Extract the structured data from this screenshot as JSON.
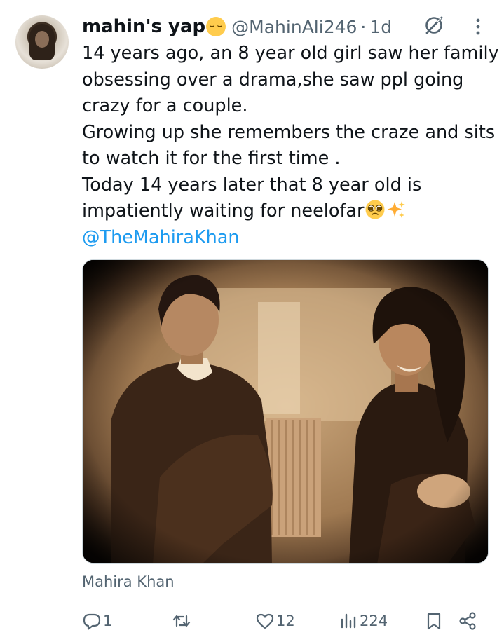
{
  "tweet": {
    "display_name": "mahin's yap",
    "name_emoji": "relieved-face-emoji",
    "handle": "@MahinAli246",
    "separator": "·",
    "time": "1d",
    "text_lines": [
      "14 years ago, an 8 year old girl saw her family",
      "obsessing over a drama,she saw ppl going",
      "crazy for a couple.",
      "Growing up she remembers the craze and sits",
      "to watch it for the first time .",
      "Today 14 years later that 8 year old is",
      "impatiently waiting for neelofar"
    ],
    "trailing_emojis": [
      "pleading-face-emoji",
      "sparkles-emoji"
    ],
    "mention": "@TheMahiraKhan",
    "media_caption": "Mahira Khan"
  },
  "actions": {
    "reply_count": "1",
    "repost_count": "",
    "like_count": "12",
    "views_count": "224"
  },
  "icons": {
    "grok": "grok-icon",
    "more": "more-icon",
    "reply": "reply-icon",
    "repost": "repost-icon",
    "like": "heart-icon",
    "views": "views-icon",
    "bookmark": "bookmark-icon",
    "share": "share-icon"
  },
  "colors": {
    "text": "#0f1419",
    "secondary": "#536471",
    "link": "#1d9bf0",
    "background": "#ffffff"
  }
}
